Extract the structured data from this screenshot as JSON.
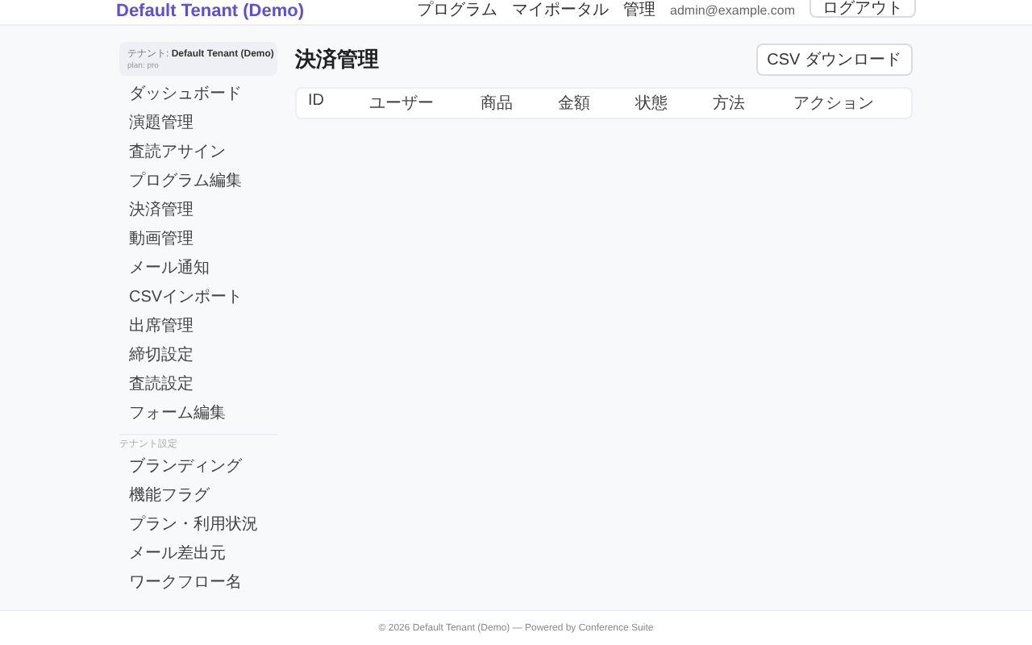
{
  "header": {
    "brand": "Default Tenant (Demo)",
    "links": [
      "プログラム",
      "マイポータル",
      "管理"
    ],
    "email": "admin@example.com",
    "logout": "ログアウト"
  },
  "sidebar": {
    "tenant": {
      "label": "テナント: **Default Tenant (Demo)**",
      "plan": "plan: pro"
    },
    "items": [
      "ダッシュボード",
      "演題管理",
      "査読アサイン",
      "プログラム編集",
      "決済管理",
      "動画管理",
      "メール通知",
      "CSVインポート",
      "出席管理",
      "締切設定",
      "査読設定",
      "フォーム編集"
    ],
    "section_label": "テナント設定",
    "section_items": [
      "ブランディング",
      "機能フラグ",
      "プラン・利用状況",
      "メール差出元",
      "ワークフロー名"
    ]
  },
  "main": {
    "title": "決済管理",
    "download_button": "CSV ダウンロード",
    "table": {
      "columns": [
        "ID",
        "ユーザー",
        "商品",
        "金額",
        "状態",
        "方法",
        "アクション"
      ]
    }
  },
  "footer": "© 2026 Default Tenant (Demo) — Powered by Conference Suite"
}
